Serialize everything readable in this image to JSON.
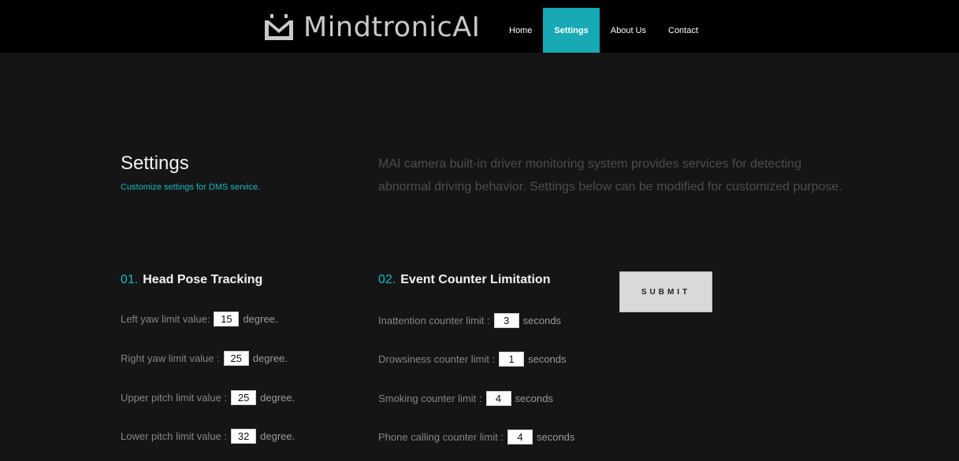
{
  "nav": {
    "brand": "MindtronicAI",
    "items": [
      {
        "label": "Home",
        "active": false
      },
      {
        "label": "Settings",
        "active": true
      },
      {
        "label": "About Us",
        "active": false
      },
      {
        "label": "Contact",
        "active": false
      }
    ],
    "active_color": "#17a9b4"
  },
  "intro": {
    "title": "Settings",
    "subtitle": "Customize settings for DMS service.",
    "description": "MAI camera built-in driver monitoring system provides services for detecting abnormal driving behavior. Settings below can be modified for customized purpose."
  },
  "head_pose": {
    "number": "01.",
    "title": "Head Pose Tracking",
    "fields": [
      {
        "label": "Left yaw limit value:",
        "value": "15",
        "unit": "degree."
      },
      {
        "label": "Right yaw limit value :",
        "value": "25",
        "unit": "degree."
      },
      {
        "label": "Upper pitch limit value :",
        "value": "25",
        "unit": "degree."
      },
      {
        "label": "Lower pitch limit value :",
        "value": "32",
        "unit": "degree."
      }
    ]
  },
  "event_counter": {
    "number": "02.",
    "title": "Event Counter Limitation",
    "fields": [
      {
        "label": "Inattention counter limit :",
        "value": "3",
        "unit": "seconds"
      },
      {
        "label": "Drowsiness counter limit :",
        "value": "1",
        "unit": "seconds"
      },
      {
        "label": "Smoking counter limit :",
        "value": "4",
        "unit": "seconds"
      },
      {
        "label": "Phone calling counter limit :",
        "value": "4",
        "unit": "seconds"
      }
    ]
  },
  "submit_label": "SUBMIT",
  "accent_color": "#19b6c1"
}
